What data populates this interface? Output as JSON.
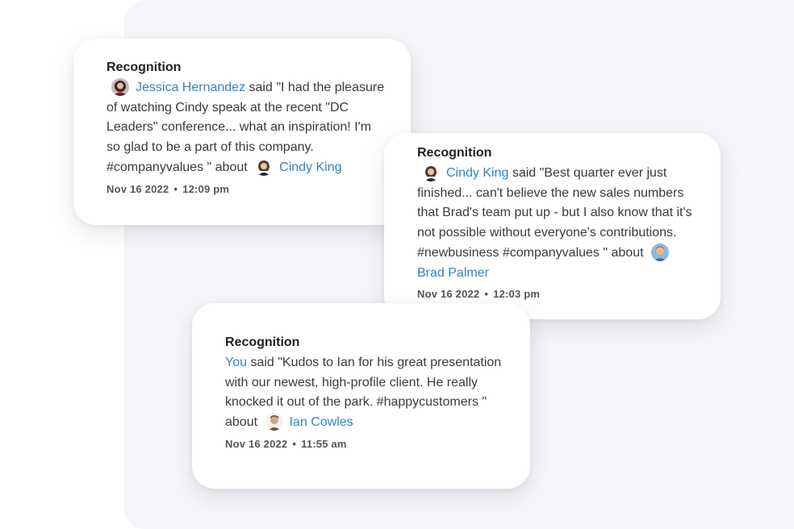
{
  "cards": [
    {
      "title": "Recognition",
      "giver": "Jessica Hernandez",
      "said_prefix": " said \"",
      "message": "I had the pleasure of watching Cindy speak at the recent \"DC Leaders\" conference... what an inspiration! I'm so glad to be a part of this company. #companyvalues",
      "message_close": " \" about",
      "recipient": "Cindy King",
      "date": "Nov 16 2022",
      "separator": "•",
      "time": "12:09 pm"
    },
    {
      "title": "Recognition",
      "giver": "Cindy King",
      "said_prefix": " said \"",
      "message": "Best quarter ever just finished... can't believe the new sales numbers that Brad's team put up - but I also know that it's not possible without everyone's contributions. #newbusiness #companyvalues",
      "message_close": " \" about",
      "recipient": "Brad Palmer",
      "date": "Nov 16 2022",
      "separator": "•",
      "time": "12:03 pm"
    },
    {
      "title": "Recognition",
      "giver": "You",
      "said_prefix": " said \"",
      "message": "Kudos to Ian for his great presentation with our newest, high-profile client. He really knocked it out of the park. #happycustomers",
      "message_close": " \" about",
      "recipient": "Ian Cowles",
      "date": "Nov 16 2022",
      "separator": "•",
      "time": "11:55 am"
    }
  ],
  "icons": {
    "avatar_jessica": "avatar-icon",
    "avatar_cindy": "avatar-icon",
    "avatar_brad": "avatar-icon",
    "avatar_ian": "avatar-icon"
  },
  "colors": {
    "link": "#2f86c6",
    "title": "#1f1f24",
    "body": "#3a3a40",
    "meta": "#55555c",
    "backdrop": "#f6f5f9"
  }
}
